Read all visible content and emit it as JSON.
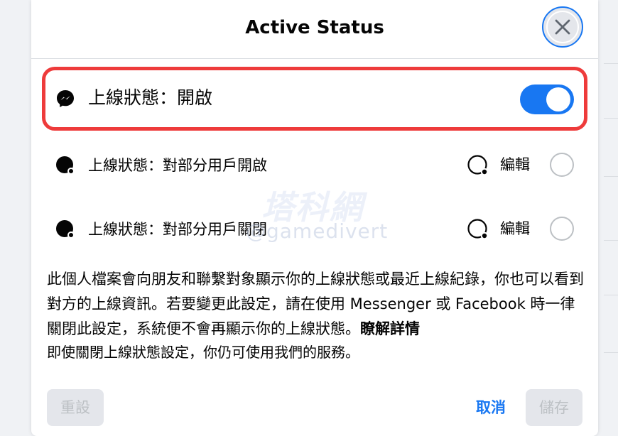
{
  "dialog": {
    "title": "Active Status"
  },
  "options": [
    {
      "label": "上線狀態：開啟",
      "control": "toggle",
      "toggle_on": true
    },
    {
      "label": "上線狀態：對部分用戶開啟",
      "edit_label": "編輯",
      "control": "radio"
    },
    {
      "label": "上線狀態：對部分用戶關閉",
      "edit_label": "編輯",
      "control": "radio"
    }
  ],
  "watermark": {
    "logo_text": "塔科網",
    "handle": "@gamedivert"
  },
  "description": {
    "text": "此個人檔案會向朋友和聯繫對象顯示你的上線狀態或最近上線紀錄，你也可以看到對方的上線資訊。若要變更此設定，請在使用 Messenger 或 Facebook 時一律關閉此設定，系統便不會再顯示你的上線狀態。",
    "link_text": "瞭解詳情",
    "note": "即使關閉上線狀態設定，你仍可使用我們的服務。"
  },
  "footer": {
    "reset_label": "重設",
    "cancel_label": "取消",
    "save_label": "儲存"
  },
  "colors": {
    "accent": "#1877f2",
    "highlight": "#ee3b3b",
    "disabled_bg": "#e4e6eb",
    "disabled_text": "#bcc0c4",
    "text_primary": "#050505"
  },
  "icons": {
    "close": "close-icon",
    "messenger": "messenger-icon",
    "status": "active-status-icon",
    "edit": "edit-status-icon"
  }
}
